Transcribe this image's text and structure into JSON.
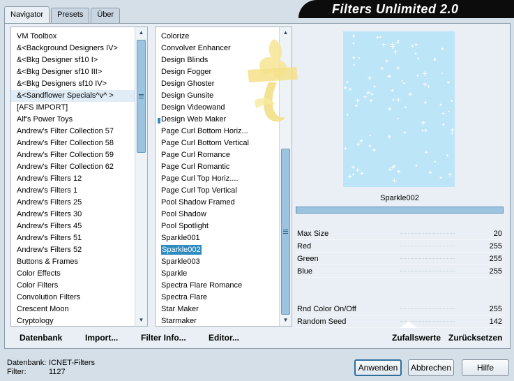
{
  "tabs": [
    "Navigator",
    "Presets",
    "Über"
  ],
  "app_title": "Filters Unlimited 2.0",
  "categories": [
    "VM Toolbox",
    "&<Background Designers IV>",
    "&<Bkg Designer sf10 I>",
    "&<Bkg Designer sf10 III>",
    "&<Bkg Designers sf10 IV>",
    "&<Sandflower Specials^v^ >",
    "[AFS IMPORT]",
    "Alf's Power Toys",
    "Andrew's Filter Collection 57",
    "Andrew's Filter Collection 58",
    "Andrew's Filter Collection 59",
    "Andrew's Filter Collection 62",
    "Andrew's Filters 12",
    "Andrew's Filters 1",
    "Andrew's Filters 25",
    "Andrew's Filters 30",
    "Andrew's Filters 45",
    "Andrew's Filters 51",
    "Andrew's Filters 52",
    "Buttons & Frames",
    "Color Effects",
    "Color Filters",
    "Convolution Filters",
    "Crescent Moon",
    "Cryptology"
  ],
  "filters": [
    "Colorize",
    "Convolver Enhancer",
    "Design Blinds",
    "Design Fogger",
    "Design Ghoster",
    "Design Gunsite",
    "Design Videowand",
    "Design Web Maker",
    "Page Curl Bottom Horiz...",
    "Page Curl Bottom Vertical",
    "Page Curl Romance",
    "Page Curl Romantic",
    "Page Curl Top Horiz....",
    "Page Curl Top Vertical",
    "Pool Shadow Framed",
    "Pool Shadow",
    "Pool Spotlight",
    "Sparkle001",
    "Sparkle002",
    "Sparkle003",
    "Sparkle",
    "Spectra Flare Romance",
    "Spectra Flare",
    "Star Maker",
    "Starmaker"
  ],
  "selected_filter": "Sparkle002",
  "params": [
    {
      "name": "Max Size",
      "value": "20"
    },
    {
      "name": "Red",
      "value": "255"
    },
    {
      "name": "Green",
      "value": "255"
    },
    {
      "name": "Blue",
      "value": "255"
    }
  ],
  "params_bottom": [
    {
      "name": "Rnd Color On/Off",
      "value": "255"
    },
    {
      "name": "Random Seed",
      "value": "142"
    }
  ],
  "toolbar": {
    "datenbank": "Datenbank",
    "import": "Import...",
    "filter_info": "Filter Info...",
    "editor": "Editor...",
    "zufallswerte": "Zufallswerte",
    "zuruecksetzen": "Zurücksetzen"
  },
  "status": {
    "db_label": "Datenbank:",
    "db_value": "ICNET-Filters",
    "filter_label": "Filter:",
    "filter_value": "1127"
  },
  "buttons": {
    "apply": "Anwenden",
    "cancel": "Abbrechen",
    "help": "Hilfe"
  },
  "colors": {
    "preview_bg": "#bde5f8",
    "selection": "#2e8bc0",
    "panel": "#e9eff4",
    "frame": "#d4dfe8"
  },
  "icons": [
    "scroll-up-icon",
    "scroll-down-icon",
    "scroll-grip-icon"
  ]
}
